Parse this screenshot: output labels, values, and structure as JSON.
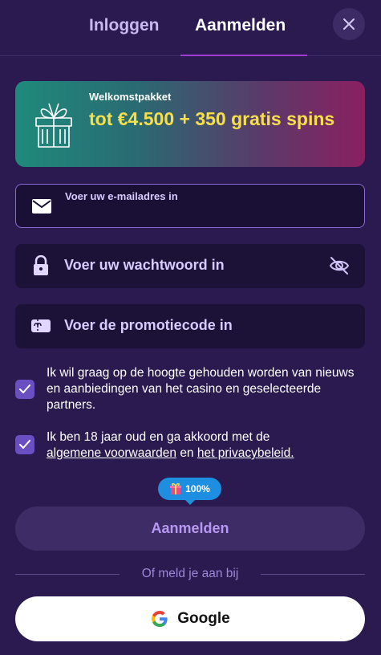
{
  "tabs": [
    {
      "label": "Inloggen",
      "active": false
    },
    {
      "label": "Aanmelden",
      "active": true
    }
  ],
  "close_icon": "close-icon",
  "promo": {
    "title": "Welkomstpakket",
    "offer": "tot €4.500 + 350 gratis spins",
    "icon": "gift-icon"
  },
  "fields": {
    "email": {
      "placeholder": "Voer uw e-mailadres in",
      "icon": "envelope-icon",
      "value": ""
    },
    "password": {
      "placeholder": "Voer uw wachtwoord in",
      "icon": "lock-icon",
      "toggle_icon": "eye-off-icon",
      "value": ""
    },
    "promo_code": {
      "placeholder": "Voer de promotiecode in",
      "icon": "ticket-icon",
      "value": ""
    }
  },
  "checkboxes": {
    "newsletter": {
      "checked": true,
      "text": "Ik wil graag op de hoogte gehouden worden van nieuws en aanbiedingen van het casino en geselecteerde partners."
    },
    "terms": {
      "checked": true,
      "text_before": "Ik ben 18 jaar oud en ga akkoord met de",
      "link_terms": "algemene voorwaarden",
      "text_middle": "en",
      "link_privacy": "het privacybeleid."
    }
  },
  "badge": {
    "icon": "gift-icon",
    "label": "100%"
  },
  "submit_label": "Aanmelden",
  "divider_text": "Of meld je aan bij",
  "google": {
    "icon": "google-icon",
    "label": "Google"
  },
  "colors": {
    "background": "#2a1a4f",
    "accent": "#a23bd6",
    "promo_text": "#f6e04a",
    "badge": "#1e8fe0",
    "checkbox": "#6a4fc2"
  }
}
